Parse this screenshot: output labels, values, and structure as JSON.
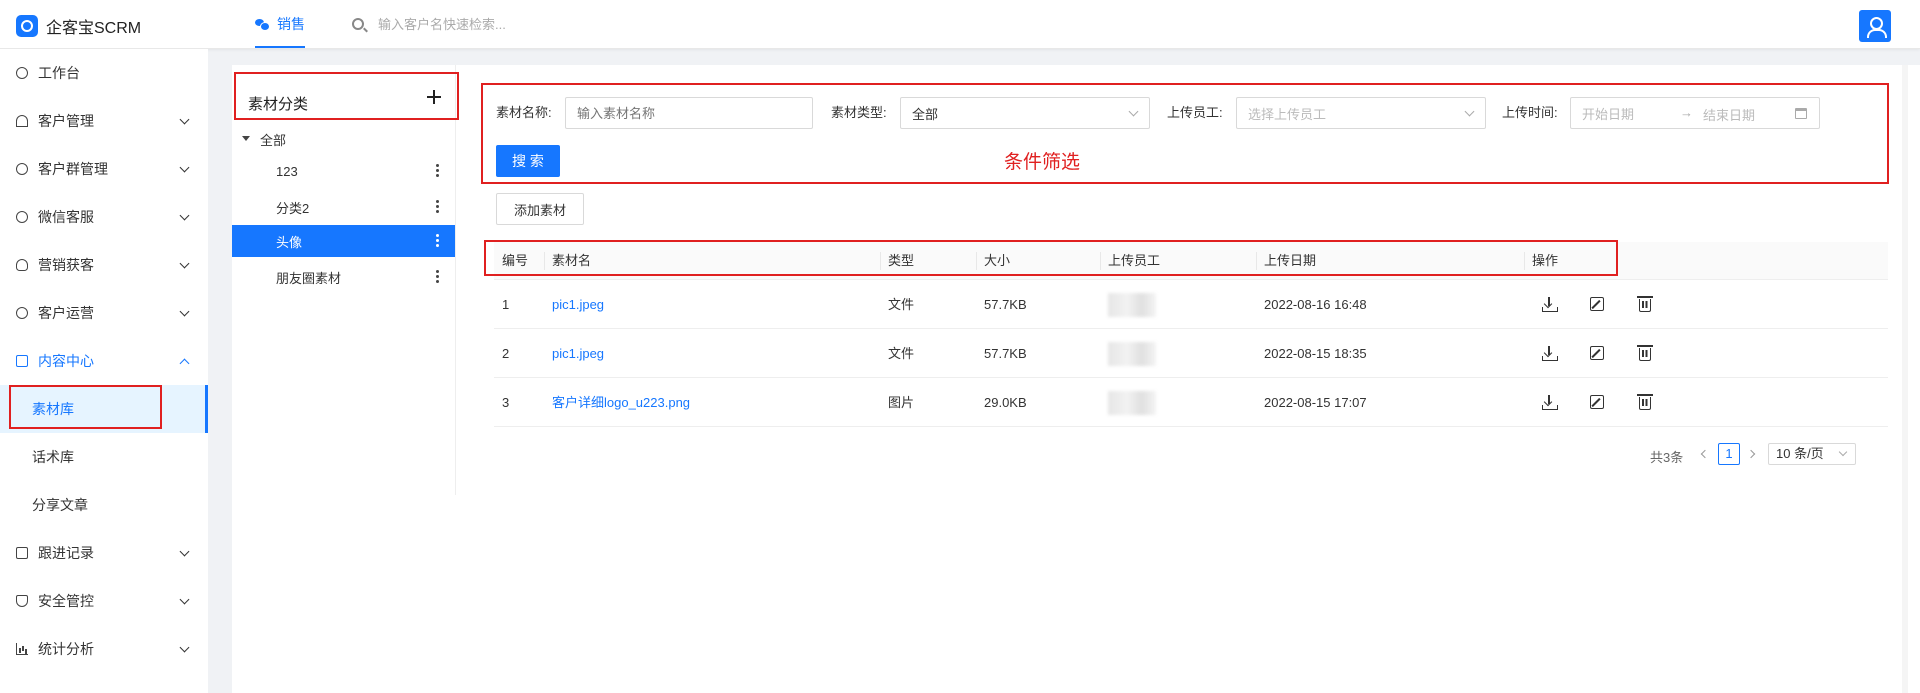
{
  "header": {
    "brand": "企客宝SCRM",
    "tab_label": "销售",
    "search_placeholder": "输入客户名快速检索..."
  },
  "sidebar": {
    "items": [
      {
        "label": "工作台"
      },
      {
        "label": "客户管理"
      },
      {
        "label": "客户群管理"
      },
      {
        "label": "微信客服"
      },
      {
        "label": "营销获客"
      },
      {
        "label": "客户运营"
      },
      {
        "label": "内容中心"
      },
      {
        "label": "跟进记录"
      },
      {
        "label": "安全管控"
      },
      {
        "label": "统计分析"
      }
    ],
    "sub_items": [
      {
        "label": "素材库"
      },
      {
        "label": "话术库"
      },
      {
        "label": "分享文章"
      }
    ]
  },
  "category": {
    "title": "素材分类",
    "root": "全部",
    "children": [
      {
        "label": "123"
      },
      {
        "label": "分类2"
      },
      {
        "label": "头像"
      },
      {
        "label": "朋友圈素材"
      }
    ]
  },
  "filters": {
    "name_label": "素材名称:",
    "name_placeholder": "输入素材名称",
    "type_label": "素材类型:",
    "type_value": "全部",
    "uploader_label": "上传员工:",
    "uploader_placeholder": "选择上传员工",
    "time_label": "上传时间:",
    "start_placeholder": "开始日期",
    "arrow": "→",
    "end_placeholder": "结束日期",
    "search_button": "搜 索",
    "annotation": "条件筛选",
    "add_button": "添加素材"
  },
  "table": {
    "headers": [
      "编号",
      "素材名",
      "类型",
      "大小",
      "上传员工",
      "上传日期",
      "操作"
    ],
    "rows": [
      {
        "id": "1",
        "name": "pic1.jpeg",
        "type": "文件",
        "size": "57.7KB",
        "date": "2022-08-16 16:48"
      },
      {
        "id": "2",
        "name": "pic1.jpeg",
        "type": "文件",
        "size": "57.7KB",
        "date": "2022-08-15 18:35"
      },
      {
        "id": "3",
        "name": "客户详细logo_u223.png",
        "type": "图片",
        "size": "29.0KB",
        "date": "2022-08-15 17:07"
      }
    ]
  },
  "pagination": {
    "total": "共3条",
    "current": "1",
    "page_size": "10 条/页"
  },
  "colors": {
    "primary": "#1677ff",
    "annotation": "#e02020"
  }
}
